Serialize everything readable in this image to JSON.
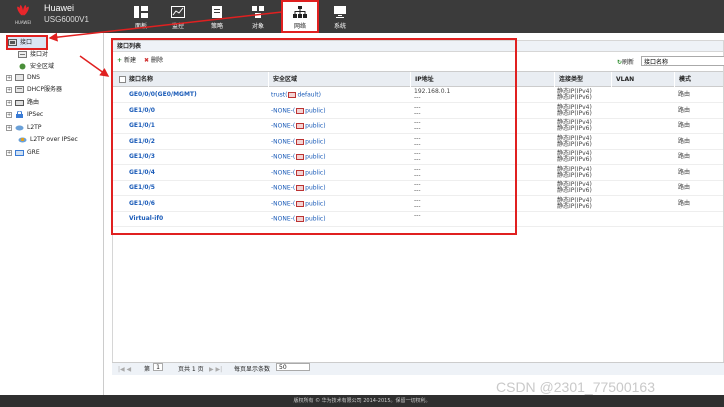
{
  "app": {
    "logo_text": "HUAWEI",
    "brand": "Huawei",
    "model": "USG6000V1"
  },
  "nav": [
    {
      "label": "面板",
      "icon": "dashboard-icon"
    },
    {
      "label": "监控",
      "icon": "monitor-icon"
    },
    {
      "label": "策略",
      "icon": "policy-icon"
    },
    {
      "label": "对象",
      "icon": "object-icon"
    },
    {
      "label": "网络",
      "icon": "network-icon",
      "active": true
    },
    {
      "label": "系统",
      "icon": "system-icon"
    }
  ],
  "sidebar": {
    "items": [
      {
        "label": "接口",
        "icon": "interface-icon",
        "selected": true
      },
      {
        "label": "接口对",
        "icon": "interface-pair-icon"
      },
      {
        "label": "安全区域",
        "icon": "security-zone-icon"
      },
      {
        "label": "DNS",
        "icon": "dns-icon",
        "expandable": true
      },
      {
        "label": "DHCP服务器",
        "icon": "dhcp-icon",
        "expandable": true
      },
      {
        "label": "路由",
        "icon": "route-icon",
        "expandable": true
      },
      {
        "label": "IPSec",
        "icon": "ipsec-icon",
        "expandable": true
      },
      {
        "label": "L2TP",
        "icon": "l2tp-icon",
        "expandable": true
      },
      {
        "label": "L2TP over IPSec",
        "icon": "l2tp-ipsec-icon"
      },
      {
        "label": "GRE",
        "icon": "gre-icon",
        "expandable": true
      }
    ]
  },
  "panel": {
    "title": "接口列表",
    "toolbar": {
      "add_label": "新建",
      "delete_label": "删除",
      "refresh_label": "刷新",
      "search_placeholder": "接口名称"
    },
    "columns": [
      "接口名称",
      "安全区域",
      "IP地址",
      "连接类型",
      "VLAN",
      "模式"
    ],
    "rows": [
      {
        "name": "GE0/0/0(GE0/MGMT)",
        "zone_prefix": "trust(",
        "zone_suffix": "default)",
        "ip": [
          "192.168.0.1",
          "---"
        ],
        "conn": [
          "静态IP(IPv4)",
          "静态IP(IPv6)"
        ],
        "vlan": "",
        "mode": "路由"
      },
      {
        "name": "GE1/0/0",
        "zone_prefix": "-NONE-(",
        "zone_suffix": "public)",
        "ip": [
          "---",
          "---"
        ],
        "conn": [
          "静态IP(IPv4)",
          "静态IP(IPv6)"
        ],
        "vlan": "",
        "mode": "路由"
      },
      {
        "name": "GE1/0/1",
        "zone_prefix": "-NONE-(",
        "zone_suffix": "public)",
        "ip": [
          "---",
          "---"
        ],
        "conn": [
          "静态IP(IPv4)",
          "静态IP(IPv6)"
        ],
        "vlan": "",
        "mode": "路由"
      },
      {
        "name": "GE1/0/2",
        "zone_prefix": "-NONE-(",
        "zone_suffix": "public)",
        "ip": [
          "---",
          "---"
        ],
        "conn": [
          "静态IP(IPv4)",
          "静态IP(IPv6)"
        ],
        "vlan": "",
        "mode": "路由"
      },
      {
        "name": "GE1/0/3",
        "zone_prefix": "-NONE-(",
        "zone_suffix": "public)",
        "ip": [
          "---",
          "---"
        ],
        "conn": [
          "静态IP(IPv4)",
          "静态IP(IPv6)"
        ],
        "vlan": "",
        "mode": "路由"
      },
      {
        "name": "GE1/0/4",
        "zone_prefix": "-NONE-(",
        "zone_suffix": "public)",
        "ip": [
          "---",
          "---"
        ],
        "conn": [
          "静态IP(IPv4)",
          "静态IP(IPv6)"
        ],
        "vlan": "",
        "mode": "路由"
      },
      {
        "name": "GE1/0/5",
        "zone_prefix": "-NONE-(",
        "zone_suffix": "public)",
        "ip": [
          "---",
          "---"
        ],
        "conn": [
          "静态IP(IPv4)",
          "静态IP(IPv6)"
        ],
        "vlan": "",
        "mode": "路由"
      },
      {
        "name": "GE1/0/6",
        "zone_prefix": "-NONE-(",
        "zone_suffix": "public)",
        "ip": [
          "---",
          "---"
        ],
        "conn": [
          "静态IP(IPv4)",
          "静态IP(IPv6)"
        ],
        "vlan": "",
        "mode": "路由"
      },
      {
        "name": "Virtual-if0",
        "zone_prefix": "-NONE-(",
        "zone_suffix": "public)",
        "ip": [
          "---",
          ""
        ],
        "conn": [
          "",
          ""
        ],
        "vlan": "",
        "mode": ""
      }
    ]
  },
  "pager": {
    "page_prefix": "第",
    "page": "1",
    "page_suffix": "页共 1 页",
    "per_page_label": "每页显示条数",
    "per_page": "50"
  },
  "footer": {
    "copyright": "版权所有 © 华为技术有限公司 2014-2015。保留一切权利。"
  },
  "watermark": "CSDN @2301_77500163",
  "colors": {
    "annotation_red": "#e02020",
    "link_blue": "#1a5bb8",
    "topbar": "#3b3b3b"
  }
}
